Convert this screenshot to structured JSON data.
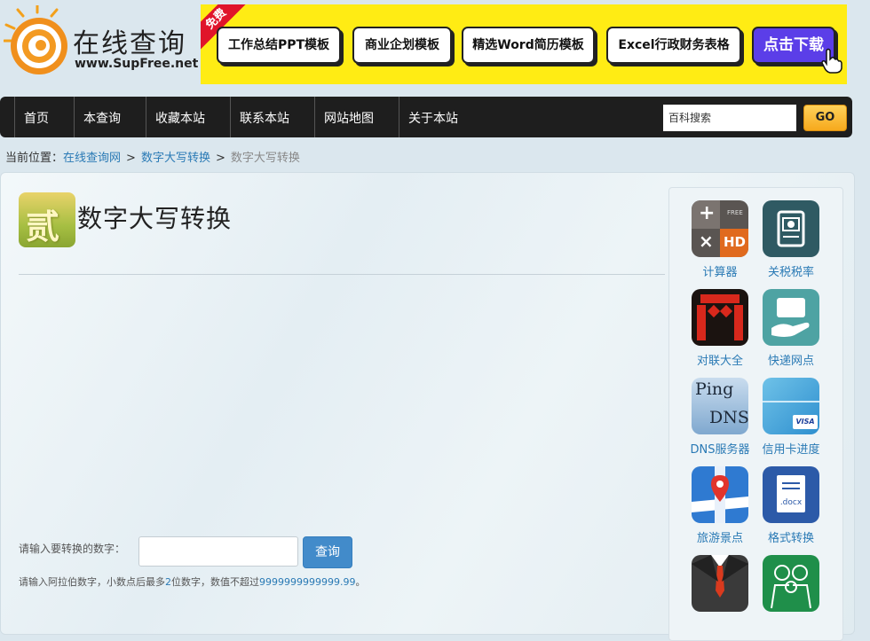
{
  "logo": {
    "title": "在线查询",
    "url": "www.SupFree.net"
  },
  "banner": {
    "ribbon": "免费",
    "buttons": [
      "工作总结PPT模板",
      "商业企划模板",
      "精选Word简历模板",
      "Excel行政财务表格"
    ],
    "download": "点击下载",
    "colors": {
      "bg": "#ffec14",
      "download": "#5b3ee8"
    }
  },
  "nav": {
    "items": [
      "首页",
      "本查询",
      "收藏本站",
      "联系本站",
      "网站地图",
      "关于本站"
    ],
    "search_placeholder": "百科搜索",
    "search_button": "GO"
  },
  "breadcrumb": {
    "prefix": "当前位置：",
    "links": [
      "在线查询网",
      "数字大写转换"
    ],
    "separator": ">",
    "current": "数字大写转换"
  },
  "tool": {
    "icon_char": "贰",
    "title": "数字大写转换",
    "input_label": "请输入要转换的数字：",
    "input_value": "",
    "button": "查询",
    "hint_before": "请输入阿拉伯数字，小数点后最多",
    "hint_digits": "2",
    "hint_middle": "位数字，数值不超过",
    "hint_max": "9999999999999.99",
    "hint_end": "。"
  },
  "sidebar": {
    "apps": [
      {
        "label": "计算器",
        "icon": "calculator-icon"
      },
      {
        "label": "关税税率",
        "icon": "tariff-icon"
      },
      {
        "label": "对联大全",
        "icon": "couplet-icon"
      },
      {
        "label": "快递网点",
        "icon": "express-icon"
      },
      {
        "label": "DNS服务器",
        "icon": "dns-icon",
        "icon_text_top": "Ping",
        "icon_text_bottom": "DNS"
      },
      {
        "label": "信用卡进度",
        "icon": "credit-card-icon",
        "card_brand": "VISA"
      },
      {
        "label": "旅游景点",
        "icon": "map-pin-icon"
      },
      {
        "label": "格式转换",
        "icon": "docx-icon",
        "icon_text": ".docx"
      },
      {
        "label": "",
        "icon": "suit-icon"
      },
      {
        "label": "",
        "icon": "family-icon"
      }
    ]
  },
  "calculator_icon_text": {
    "free": "FREE",
    "hd": "HD"
  }
}
